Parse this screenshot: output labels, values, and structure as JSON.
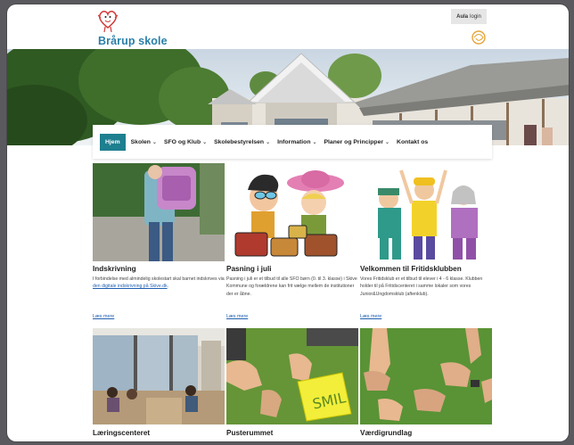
{
  "header": {
    "site_title": "Brårup skole",
    "login": {
      "bold": "Aula",
      "rest": "login"
    }
  },
  "nav": {
    "items": [
      {
        "label": "Hjem",
        "active": true,
        "dropdown": false
      },
      {
        "label": "Skolen",
        "dropdown": true
      },
      {
        "label": "SFO og Klub",
        "dropdown": true
      },
      {
        "label": "Skolebestyrelsen",
        "dropdown": true
      },
      {
        "label": "Information",
        "dropdown": true
      },
      {
        "label": "Planer og Principper",
        "dropdown": true
      },
      {
        "label": "Kontakt os",
        "dropdown": false
      }
    ]
  },
  "cards": [
    {
      "title": "Indskrivning",
      "text_before": "I forbindelse med almindelig skolestart skal barnet indskrives via ",
      "link": "den digitale indskrivning på Skive.dk",
      "text_after": ".",
      "read_more": "Læs mere"
    },
    {
      "title": "Pasning i juli",
      "text": "Pasning i juli er et tilbud til alle SFO børn (0. til 3. klasse) i Skive Kommune og forældrene kan frit vælge mellem de institutioner der er åbne.",
      "read_more": "Læs mere"
    },
    {
      "title": "Velkommen til Fritidsklubben",
      "text": "Vores Fritidsklub er et tilbud til elever i 4 - 6 klasse. Klubben holder til på Fritidscenteret i samme lokaler som vores Junior&Ungdomsklub (aftenklub).",
      "read_more": "Læs mere"
    },
    {
      "title": "Læringscenteret"
    },
    {
      "title": "Pusterummet",
      "sign_text": "SMIL"
    },
    {
      "title": "Værdigrundlag"
    }
  ],
  "colors": {
    "accent": "#1e7f8f",
    "title_blue": "#2a7fa8",
    "link": "#1f5fb0"
  }
}
